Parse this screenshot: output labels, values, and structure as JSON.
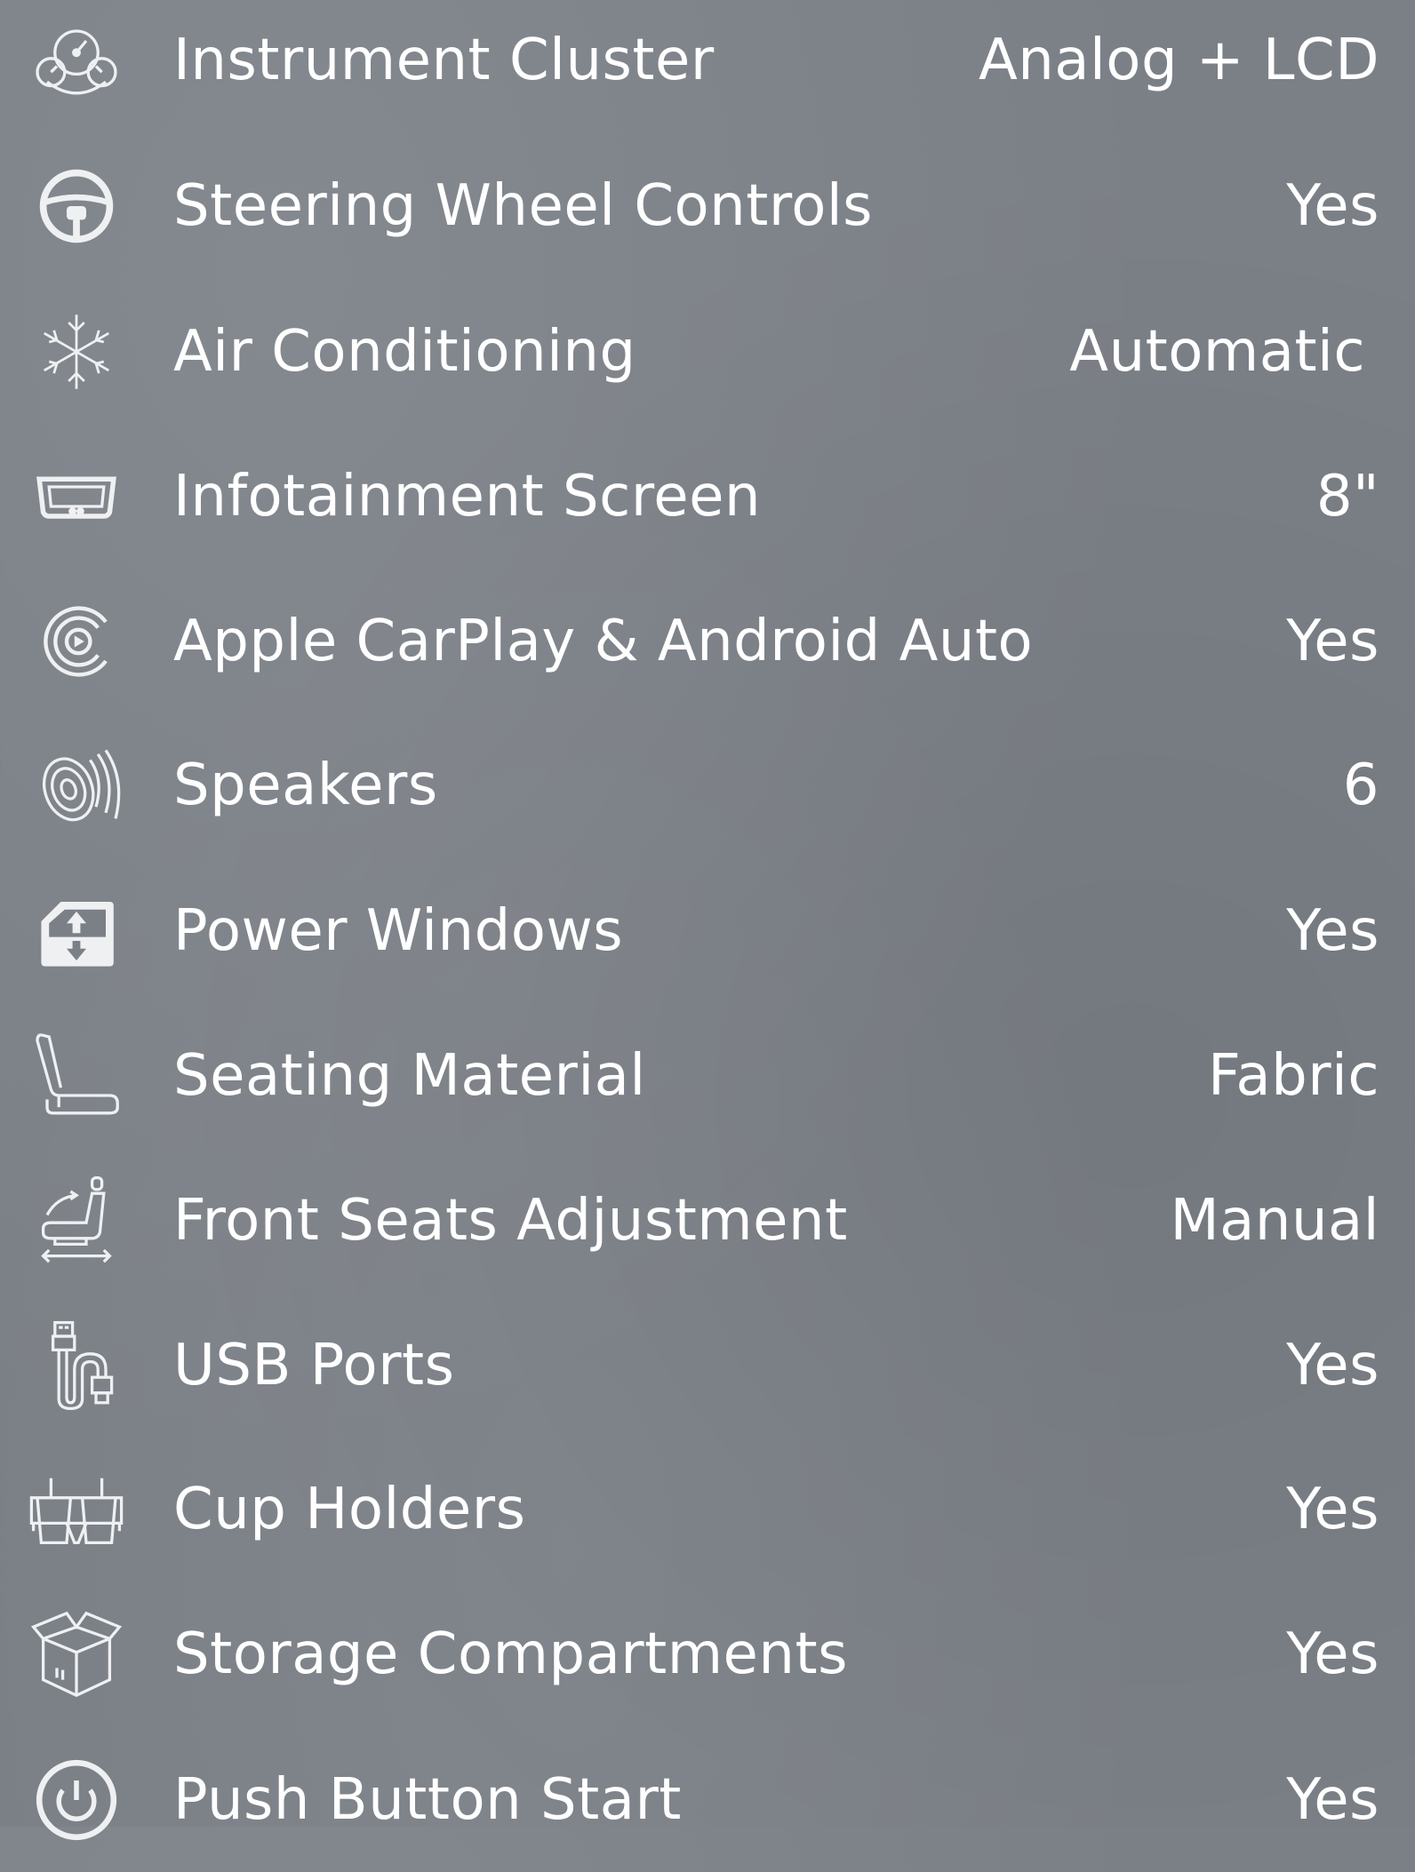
{
  "features": [
    {
      "icon": "instrument-cluster-icon",
      "label": "Instrument Cluster",
      "value": "Analog + LCD"
    },
    {
      "icon": "steering-wheel-icon",
      "label": "Steering Wheel Controls",
      "value": "Yes"
    },
    {
      "icon": "snowflake-icon",
      "label": "Air Conditioning",
      "value": "Automatic"
    },
    {
      "icon": "screen-icon",
      "label": "Infotainment Screen",
      "value": "8\""
    },
    {
      "icon": "carplay-icon",
      "label": "Apple CarPlay & Android Auto",
      "value": "Yes"
    },
    {
      "icon": "speaker-icon",
      "label": "Speakers",
      "value": "6"
    },
    {
      "icon": "power-window-icon",
      "label": "Power Windows",
      "value": "Yes"
    },
    {
      "icon": "seat-icon",
      "label": "Seating Material",
      "value": "Fabric"
    },
    {
      "icon": "seat-adjust-icon",
      "label": "Front Seats Adjustment",
      "value": "Manual"
    },
    {
      "icon": "usb-icon",
      "label": "USB Ports",
      "value": "Yes"
    },
    {
      "icon": "cup-holder-icon",
      "label": "Cup Holders",
      "value": "Yes"
    },
    {
      "icon": "storage-box-icon",
      "label": "Storage Compartments",
      "value": "Yes"
    },
    {
      "icon": "power-button-icon",
      "label": "Push Button Start",
      "value": "Yes"
    }
  ]
}
